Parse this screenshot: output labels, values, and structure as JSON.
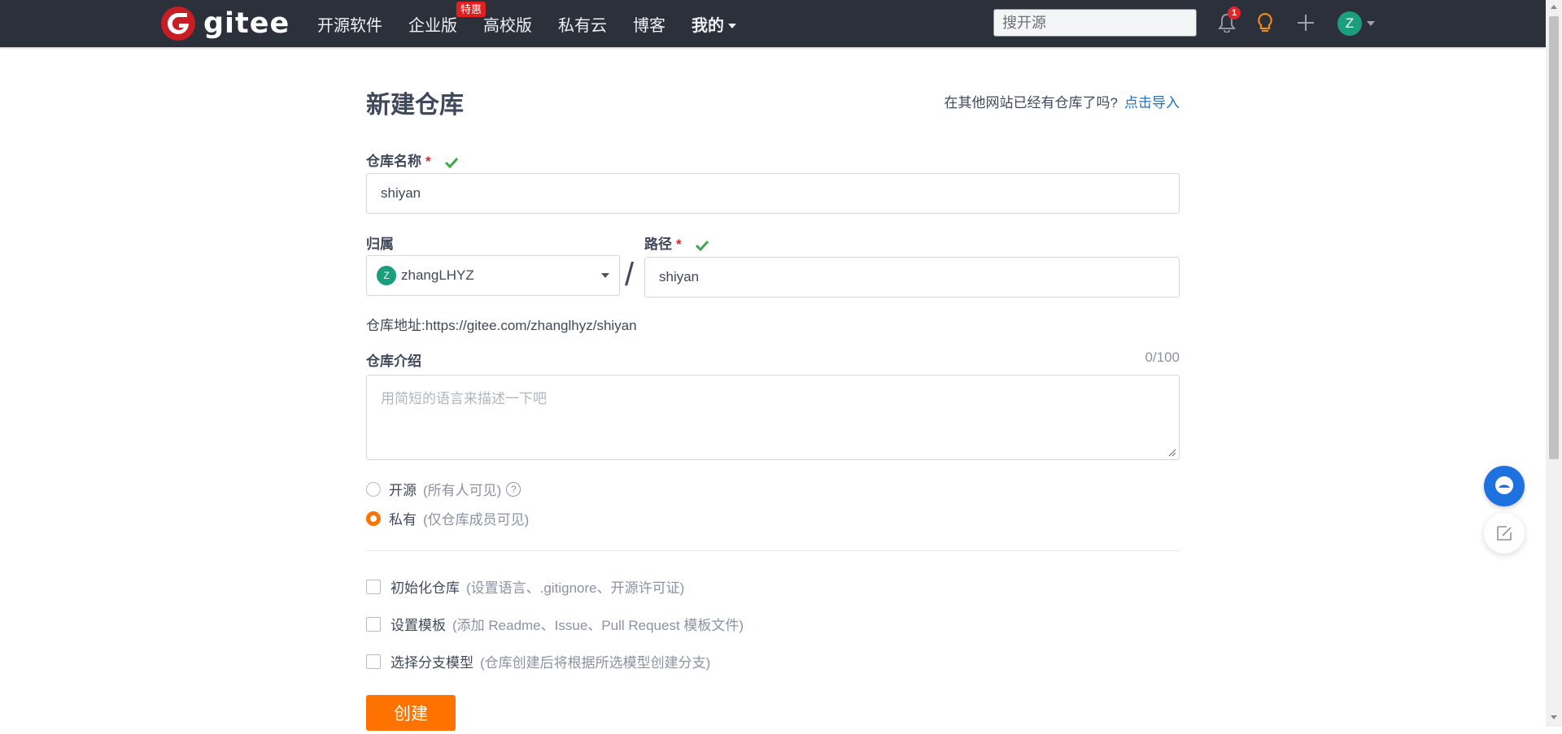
{
  "header": {
    "logo_text": "gitee",
    "nav": [
      {
        "label": "开源软件"
      },
      {
        "label": "企业版",
        "badge": "特惠"
      },
      {
        "label": "高校版"
      },
      {
        "label": "私有云"
      },
      {
        "label": "博客"
      },
      {
        "label": "我的"
      }
    ],
    "search_placeholder": "搜开源",
    "notification_count": "1",
    "avatar_letter": "Z"
  },
  "form": {
    "title": "新建仓库",
    "import_prompt": "在其他网站已经有仓库了吗?",
    "import_link": "点击导入",
    "name_label": "仓库名称",
    "required_mark": "*",
    "name_value": "shiyan",
    "owner_label": "归属",
    "owner_avatar": "Z",
    "owner_value": "zhangLHYZ",
    "separator": "/",
    "path_label": "路径",
    "path_value": "shiyan",
    "repo_url_label": "仓库地址:",
    "repo_url": "https://gitee.com/zhanglhyz/shiyan",
    "desc_label": "仓库介绍",
    "desc_counter": "0/100",
    "desc_placeholder": "用简短的语言来描述一下吧",
    "visibility": {
      "selected": "private",
      "public_label": "开源",
      "public_hint": "(所有人可见)",
      "private_label": "私有",
      "private_hint": "(仅仓库成员可见)"
    },
    "options": [
      {
        "label": "初始化仓库",
        "hint": "(设置语言、.gitignore、开源许可证)",
        "checked": false
      },
      {
        "label": "设置模板",
        "hint": "(添加 Readme、Issue、Pull Request 模板文件)",
        "checked": false
      },
      {
        "label": "选择分支模型",
        "hint": "(仓库创建后将根据所选模型创建分支)",
        "checked": false
      }
    ],
    "submit_label": "创建"
  },
  "colors": {
    "nav_bg": "#2b303b",
    "brand_red": "#c71d23",
    "accent_orange": "#fe7300",
    "link_blue": "#1e72c5",
    "success_green": "#3ba84a"
  }
}
